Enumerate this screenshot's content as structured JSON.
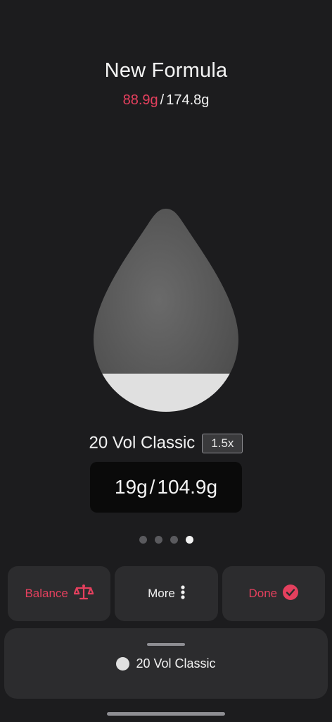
{
  "header": {
    "title": "New Formula",
    "current_weight": "88.9g",
    "separator": "/",
    "total_weight": "174.8g"
  },
  "drop": {
    "fill_fraction": 0.19,
    "fill_color": "#e0e0e0",
    "body_color": "#5c5c5c"
  },
  "product": {
    "name": "20 Vol Classic",
    "multiplier": "1.5x",
    "amount_current": "19g",
    "amount_separator": "/",
    "amount_total": "104.9g"
  },
  "pager": {
    "count": 4,
    "active_index": 3
  },
  "actions": {
    "balance_label": "Balance",
    "balance_icon": "scale-icon",
    "more_label": "More",
    "more_icon": "vertical-ellipsis-icon",
    "done_label": "Done",
    "done_icon": "check-circle-icon"
  },
  "sheet": {
    "item_label": "20 Vol Classic",
    "item_color": "#e0e0e0"
  },
  "colors": {
    "accent": "#e5405e",
    "background": "#1c1c1e",
    "surface": "#2c2c2e"
  }
}
